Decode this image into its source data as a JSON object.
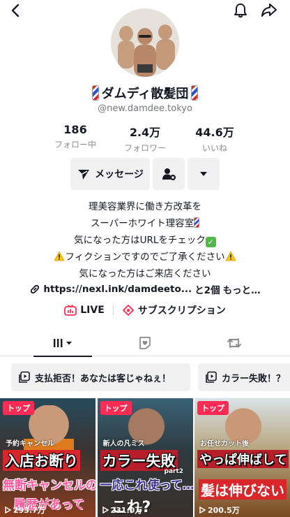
{
  "profile": {
    "display_name": "ダムディ散髪団",
    "username": "@new.damdee.tokyo"
  },
  "stats": [
    {
      "value": "186",
      "label": "フォロー中"
    },
    {
      "value": "2.4万",
      "label": "フォロワー"
    },
    {
      "value": "44.6万",
      "label": "いいね"
    }
  ],
  "actions": {
    "message_label": "メッセージ"
  },
  "bio": {
    "line1": "理美容業界に働き方改革を",
    "line2": "スーパーホワイト理容室",
    "line3": "気になった方はURLをチェック",
    "line4": "フィクションですのでご了承ください",
    "line5": "気になった方はご来店ください"
  },
  "link": {
    "url": "https://nexl.ink/damdeeto...",
    "extra": "と2個",
    "more": "もっと…"
  },
  "pills": {
    "live": "LIVE",
    "subscription": "サブスクリプション"
  },
  "playlists": [
    {
      "label": "支払拒否！あなたは客じゃねぇ！"
    },
    {
      "label": "カラー失敗！？"
    }
  ],
  "videos": [
    {
      "badge": "トップ",
      "caption_small": "予約キャンセル",
      "caption_big": "入店お断り",
      "caption_sub": "無断キャンセルの",
      "caption_sub2": "履歴があって",
      "views": "293.7万"
    },
    {
      "badge": "トップ",
      "caption_small": "新人の凡ミス",
      "caption_big": "カラー失敗",
      "caption_tag": "part2",
      "caption_sub": "一応これ使って…",
      "caption_sub2": "これ?",
      "views": "231.0万"
    },
    {
      "badge": "トップ",
      "caption_small": "お任せカット後",
      "caption_big": "やっぱ伸ばして",
      "caption_sub": "髪は伸びない",
      "views": "200.5万"
    }
  ],
  "icons": [
    "back-icon",
    "bell-icon",
    "share-icon",
    "send-icon",
    "add-friend-icon",
    "dropdown-icon",
    "link-icon",
    "live-icon",
    "subscription-icon",
    "videos-tab-icon",
    "favorites-tab-icon",
    "repost-tab-icon",
    "playlist-icon",
    "play-icon"
  ],
  "colors": {
    "accent": "#fe2c55",
    "text_primary": "#161823",
    "text_secondary": "#75767b",
    "button_bg": "#f1f1f2"
  }
}
